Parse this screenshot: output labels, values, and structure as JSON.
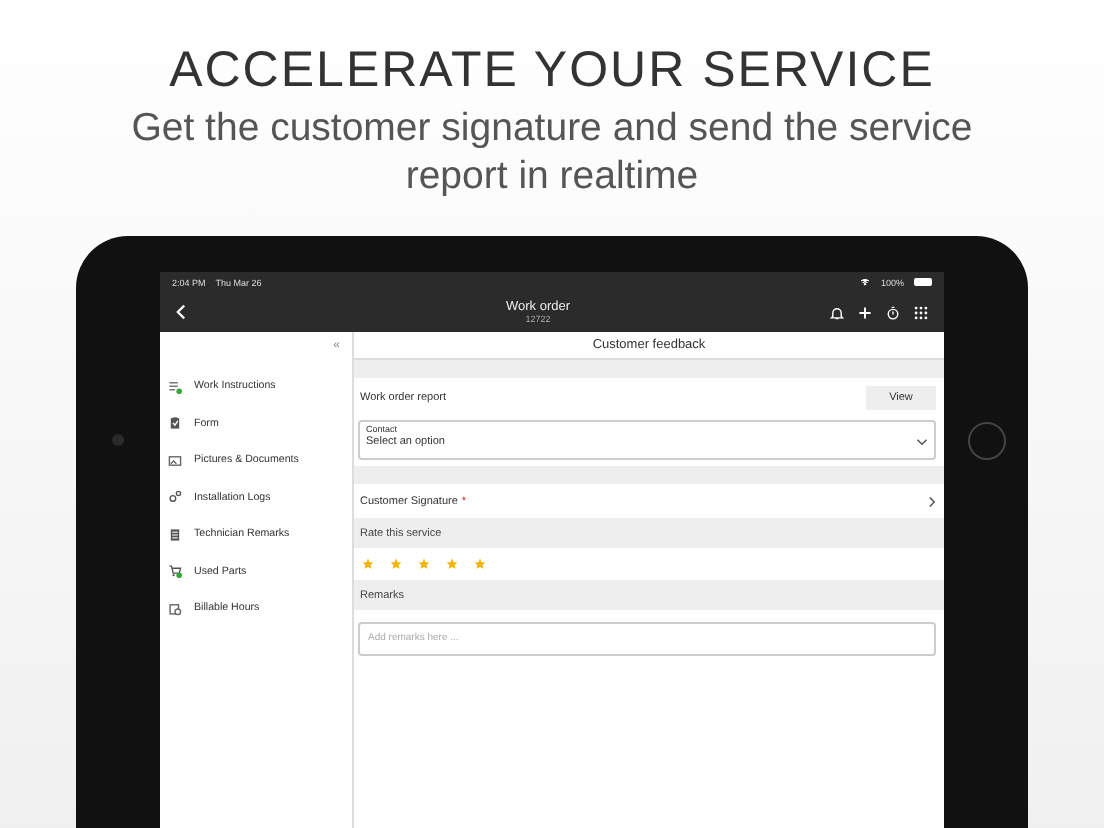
{
  "headline": "ACCELERATE YOUR SERVICE",
  "subheadline": "Get the customer signature and send the service report in realtime",
  "status_bar": {
    "time": "2:04 PM",
    "date": "Thu Mar 26",
    "battery": "100%"
  },
  "nav_bar": {
    "title": "Work order",
    "subtitle": "12722"
  },
  "sidebar": {
    "collapse": "«",
    "items": [
      {
        "label": "Work Instructions",
        "completed": true
      },
      {
        "label": "Form",
        "completed": false
      },
      {
        "label": "Pictures & Documents",
        "completed": false
      },
      {
        "label": "Installation Logs",
        "completed": false
      },
      {
        "label": "Technician Remarks",
        "completed": false
      },
      {
        "label": "Used Parts",
        "completed": true
      },
      {
        "label": "Billable Hours",
        "completed": false
      }
    ]
  },
  "panel": {
    "title": "Customer feedback",
    "report": {
      "label": "Work order report",
      "button": "View"
    },
    "contact": {
      "label": "Contact",
      "value": "Select an option"
    },
    "signature": {
      "label": "Customer Signature",
      "marker": "*"
    },
    "rating": {
      "label": "Rate this service",
      "stars": 5
    },
    "remarks": {
      "label": "Remarks",
      "placeholder": "Add remarks here ..."
    }
  }
}
